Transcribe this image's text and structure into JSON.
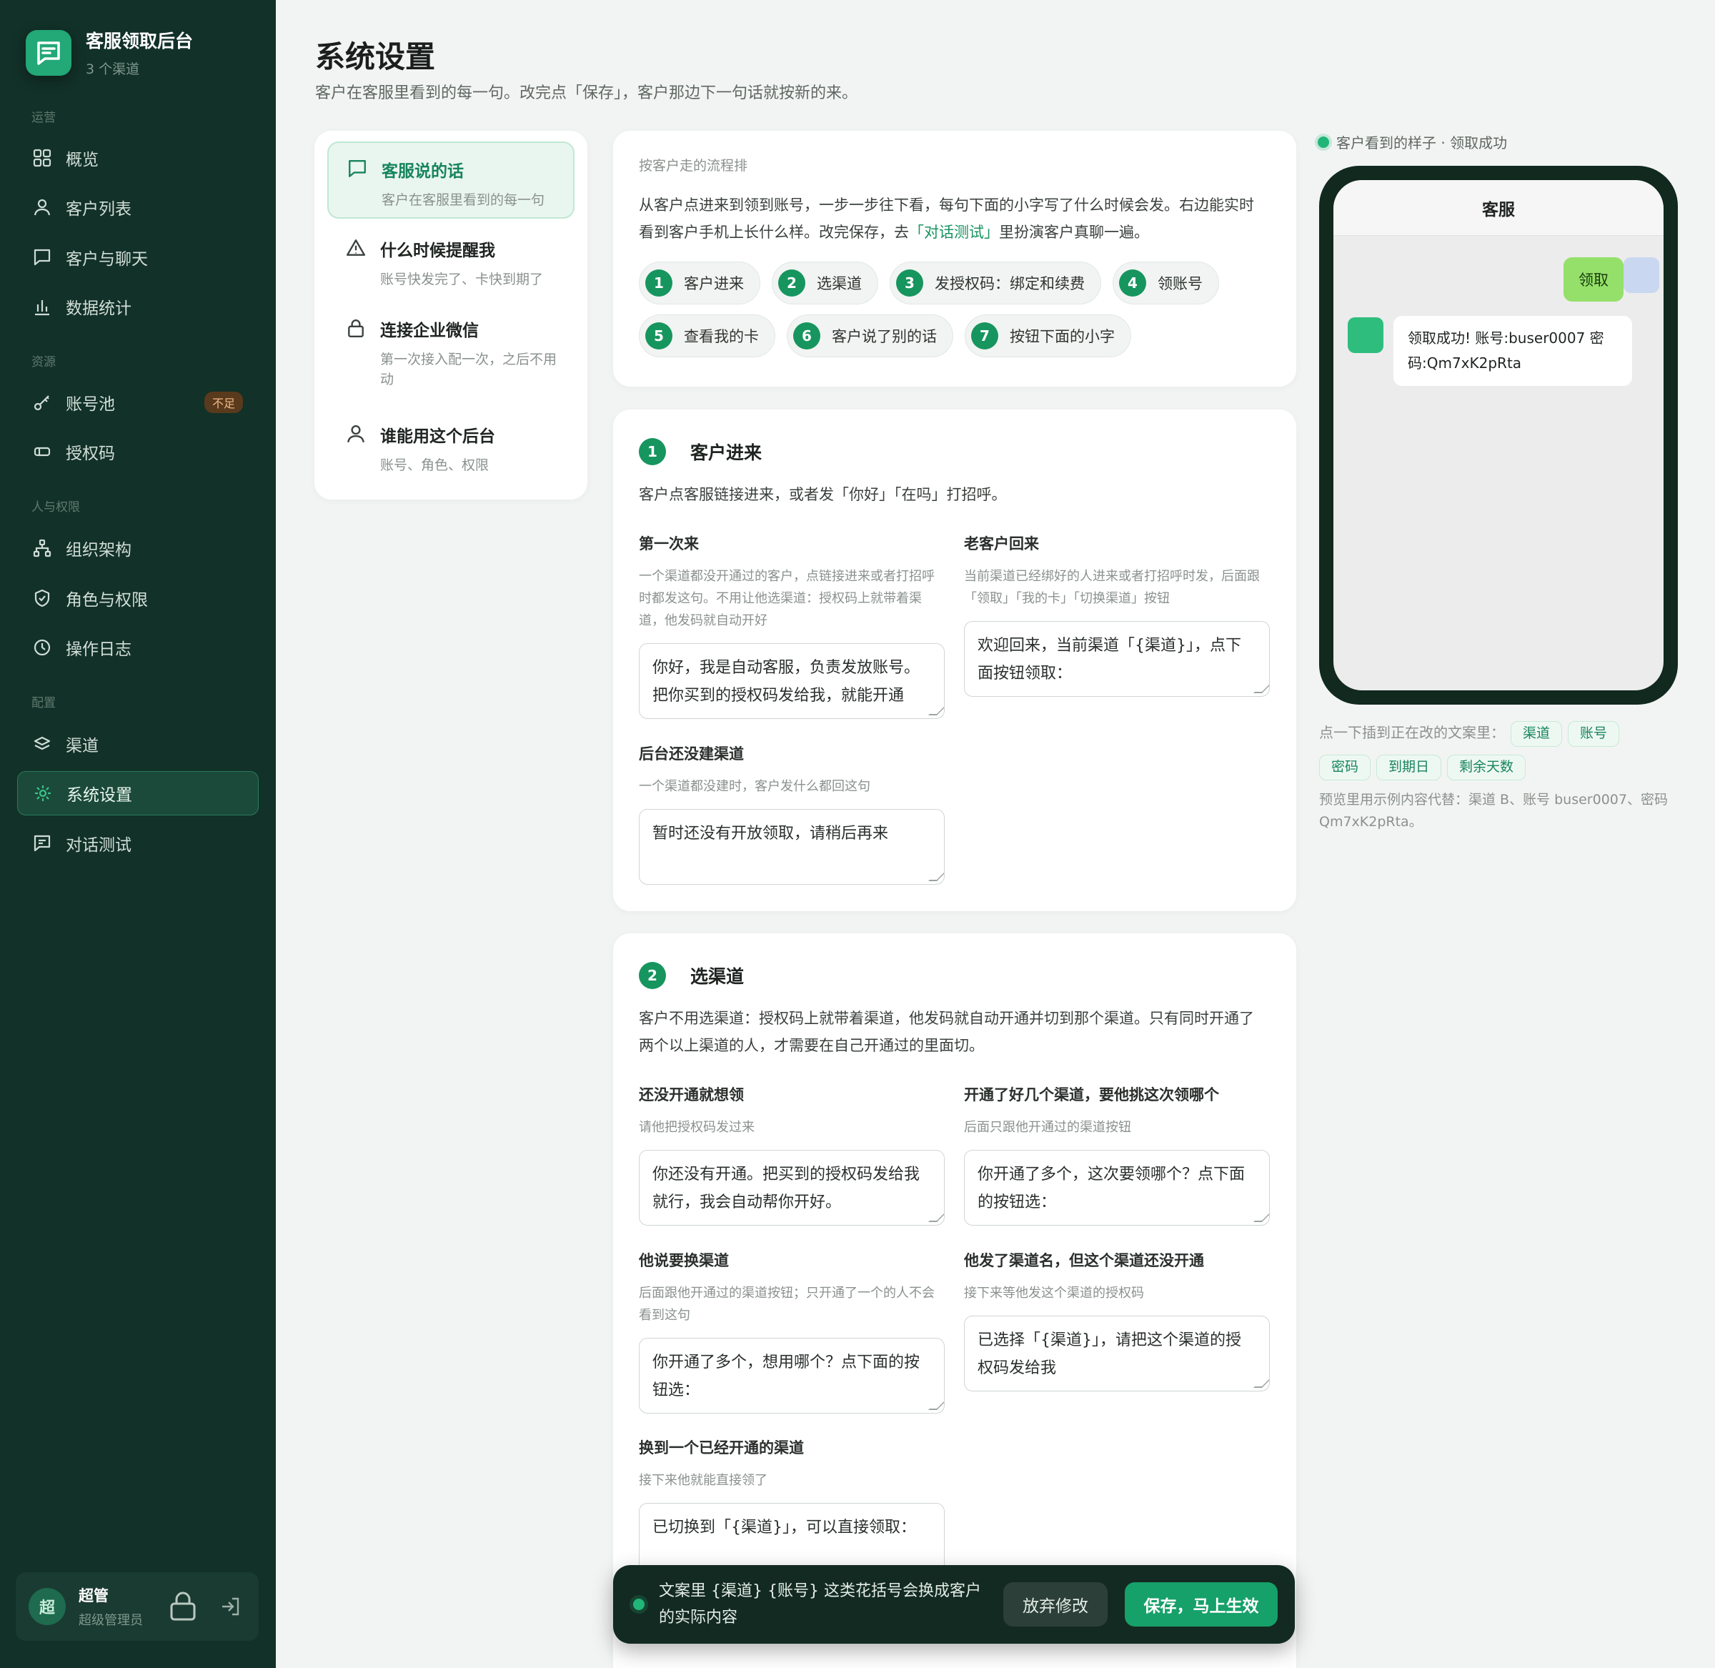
{
  "app": {
    "name": "客服领取后台",
    "channels": "3 个渠道"
  },
  "nav": {
    "groups": [
      "运营",
      "资源",
      "人与权限",
      "配置"
    ],
    "items": [
      {
        "label": "概览",
        "icon": "grid-icon"
      },
      {
        "label": "客户列表",
        "icon": "user-icon"
      },
      {
        "label": "客户与聊天",
        "icon": "chat-icon"
      },
      {
        "label": "数据统计",
        "icon": "bar-chart-icon"
      },
      {
        "label": "账号池",
        "icon": "key-icon",
        "badge": "不足"
      },
      {
        "label": "授权码",
        "icon": "ticket-icon"
      },
      {
        "label": "组织架构",
        "icon": "org-icon"
      },
      {
        "label": "角色与权限",
        "icon": "shield-icon"
      },
      {
        "label": "操作日志",
        "icon": "clock-icon"
      },
      {
        "label": "渠道",
        "icon": "layers-icon"
      },
      {
        "label": "系统设置",
        "icon": "settings-icon",
        "active": true
      },
      {
        "label": "对话测试",
        "icon": "chat-test-icon"
      }
    ]
  },
  "user": {
    "avatar": "超",
    "name": "超管",
    "role": "超级管理员"
  },
  "page": {
    "title": "系统设置",
    "subtitle": "客户在客服里看到的每一句。改完点「保存」，客户那边下一句话就按新的来。"
  },
  "settings_menu": [
    {
      "title": "客服说的话",
      "desc": "客户在客服里看到的每一句"
    },
    {
      "title": "什么时候提醒我",
      "desc": "账号快发完了、卡快到期了"
    },
    {
      "title": "连接企业微信",
      "desc": "第一次接入配一次，之后不用动"
    },
    {
      "title": "谁能用这个后台",
      "desc": "账号、角色、权限"
    }
  ],
  "flow": {
    "label": "按客户走的流程排",
    "desc_a": "从客户点进来到领到账号，一步一步往下看，每句下面的小字写了什么时候会发。右边能实时看到客户手机上长什么样。改完保存，去",
    "link": "「对话测试」",
    "desc_b": "里扮演客户真聊一遍。",
    "steps": [
      {
        "n": "1",
        "label": "客户进来"
      },
      {
        "n": "2",
        "label": "选渠道"
      },
      {
        "n": "3",
        "label": "发授权码：绑定和续费"
      },
      {
        "n": "4",
        "label": "领账号"
      },
      {
        "n": "5",
        "label": "查看我的卡"
      },
      {
        "n": "6",
        "label": "客户说了别的话"
      },
      {
        "n": "7",
        "label": "按钮下面的小字"
      }
    ]
  },
  "s1": {
    "n": "1",
    "title": "客户进来",
    "desc": "客户点客服链接进来，或者发「你好」「在吗」打招呼。",
    "fields": [
      {
        "label": "第一次来",
        "help": "一个渠道都没开通过的客户，点链接进来或者打招呼时都发这句。不用让他选渠道：授权码上就带着渠道，他发码就自动开好",
        "value": "你好，我是自动客服，负责发放账号。把你买到的授权码发给我，就能开通"
      },
      {
        "label": "老客户回来",
        "help": "当前渠道已经绑好的人进来或者打招呼时发，后面跟「领取」「我的卡」「切换渠道」按钮",
        "value": "欢迎回来，当前渠道「{渠道}」，点下面按钮领取："
      },
      {
        "label": "后台还没建渠道",
        "help": "一个渠道都没建时，客户发什么都回这句",
        "value": "暂时还没有开放领取，请稍后再来"
      }
    ]
  },
  "s2": {
    "n": "2",
    "title": "选渠道",
    "desc": "客户不用选渠道：授权码上就带着渠道，他发码就自动开通并切到那个渠道。只有同时开通了两个以上渠道的人，才需要在自己开通过的里面切。",
    "fields": [
      {
        "label": "还没开通就想领",
        "help": "请他把授权码发过来",
        "value": "你还没有开通。把买到的授权码发给我就行，我会自动帮你开好。"
      },
      {
        "label": "开通了好几个渠道，要他挑这次领哪个",
        "help": "后面只跟他开通过的渠道按钮",
        "value": "你开通了多个，这次要领哪个？点下面的按钮选："
      },
      {
        "label": "他说要换渠道",
        "help": "后面跟他开通过的渠道按钮；只开通了一个的人不会看到这句",
        "value": "你开通了多个，想用哪个？点下面的按钮选："
      },
      {
        "label": "他发了渠道名，但这个渠道还没开通",
        "help": "接下来等他发这个渠道的授权码",
        "value": "已选择「{渠道}」，请把这个渠道的授权码发给我"
      },
      {
        "label": "换到一个已经开通的渠道",
        "help": "接下来他就能直接领了",
        "value": "已切换到「{渠道}」，可以直接领取："
      }
    ]
  },
  "toast": {
    "text": "文案里 {渠道} {账号} 这类花括号会换成客户的实际内容",
    "discard": "放弃修改",
    "save": "保存，马上生效"
  },
  "preview": {
    "status": "客户看到的样子 · 领取成功",
    "chat_title": "客服",
    "out_msg": "领取",
    "in_msg": "领取成功! 账号:buser0007 密码:Qm7xK2pRta",
    "insert_label": "点一下插到正在改的文案里：",
    "tags": [
      "渠道",
      "账号",
      "密码",
      "到期日",
      "剩余天数"
    ],
    "note": "预览里用示例内容代替：渠道 B、账号 buser0007、密码 Qm7xK2pRta。"
  },
  "colors": {
    "sidebar": "#123128",
    "accent": "#17955f",
    "page_bg": "#f2f4f3",
    "badge_warn": "#5a3a1c"
  }
}
